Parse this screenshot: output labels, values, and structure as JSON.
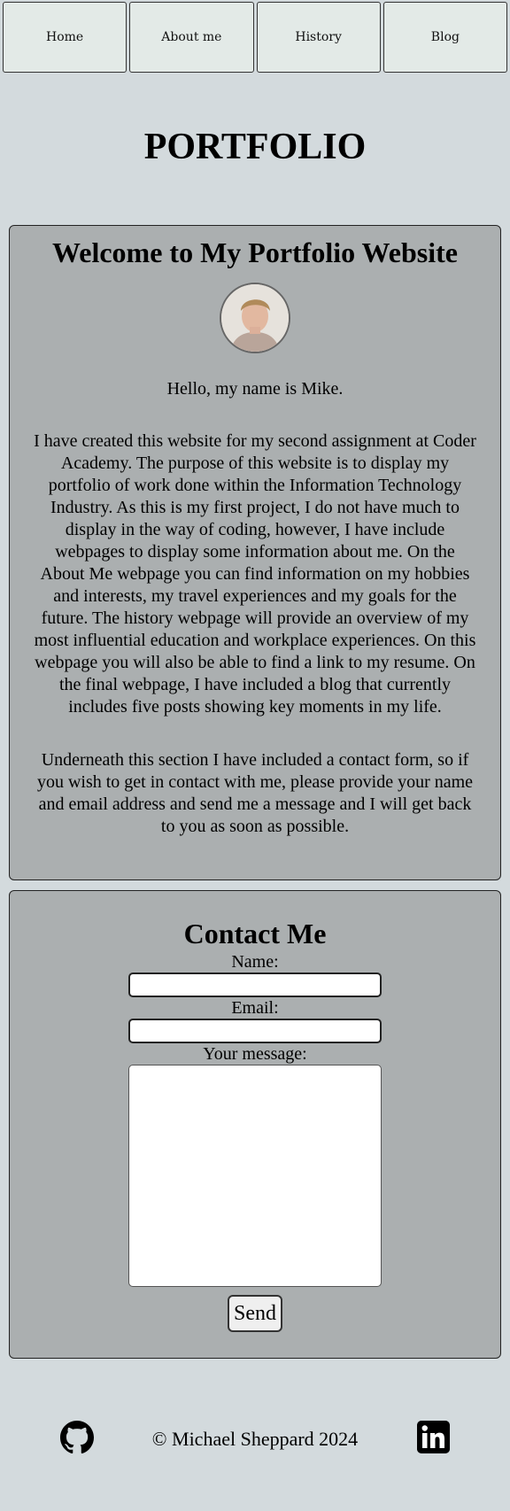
{
  "nav": {
    "items": [
      {
        "label": "Home"
      },
      {
        "label": "About me"
      },
      {
        "label": "History"
      },
      {
        "label": "Blog"
      }
    ]
  },
  "header": {
    "title": "PORTFOLIO"
  },
  "welcome": {
    "heading": "Welcome to My Portfolio Website",
    "greeting": "Hello, my name is Mike.",
    "paragraph1": "I have created this website for my second assignment at Coder Academy. The purpose of this website is to display my portfolio of work done within the Information Technology Industry. As this is my first project, I do not have much to display in the way of coding, however, I have include webpages to display some information about me. On the About Me webpage you can find information on my hobbies and interests, my travel experiences and my goals for the future. The history webpage will provide an overview of my most influential education and workplace experiences. On this webpage you will also be able to find a link to my resume. On the final webpage, I have included a blog that currently includes five posts showing key moments in my life.",
    "paragraph2": "Underneath this section I have included a contact form, so if you wish to get in contact with me, please provide your name and email address and send me a message and I will get back to you as soon as possible."
  },
  "contact": {
    "heading": "Contact Me",
    "name_label": "Name:",
    "name_value": "",
    "email_label": "Email:",
    "email_value": "",
    "message_label": "Your message:",
    "message_value": "",
    "send_label": "Send"
  },
  "footer": {
    "copyright": "© Michael Sheppard 2024",
    "icons": [
      "github-icon",
      "linkedin-icon"
    ]
  },
  "colors": {
    "background": "#d3dadd",
    "nav_button": "#e3eae7",
    "card": "#abafb0"
  }
}
